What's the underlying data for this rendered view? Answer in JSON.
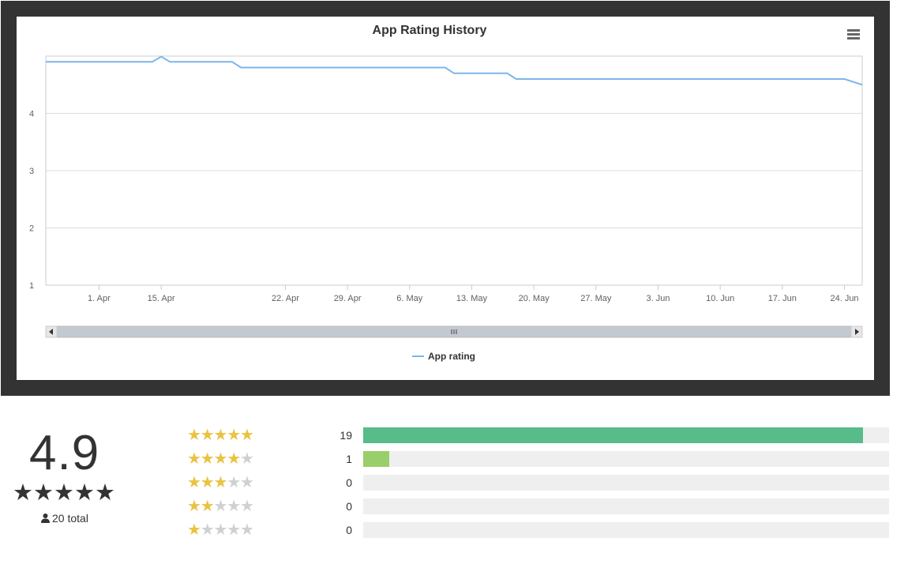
{
  "chart_data": {
    "type": "line",
    "title": "App Rating History",
    "xlabel": "",
    "ylabel": "",
    "x_range": [
      "2019-03-26",
      "2019-06-26"
    ],
    "ylim": [
      1,
      5
    ],
    "y_ticks": [
      "1",
      "2",
      "3",
      "4"
    ],
    "x_ticks": [
      {
        "date": "2019-04-01",
        "label": "1. Apr"
      },
      {
        "date": "2019-04-08",
        "label": "15. Apr",
        "shown_date": "2019-04-15"
      },
      {
        "date": "2019-04-22",
        "label": "22. Apr"
      },
      {
        "date": "2019-04-29",
        "label": "29. Apr"
      },
      {
        "date": "2019-05-06",
        "label": "6. May"
      },
      {
        "date": "2019-05-13",
        "label": "13. May"
      },
      {
        "date": "2019-05-20",
        "label": "20. May"
      },
      {
        "date": "2019-05-27",
        "label": "27. May"
      },
      {
        "date": "2019-06-03",
        "label": "3. Jun"
      },
      {
        "date": "2019-06-10",
        "label": "10. Jun"
      },
      {
        "date": "2019-06-17",
        "label": "17. Jun"
      },
      {
        "date": "2019-06-24",
        "label": "24. Jun"
      }
    ],
    "grid": true,
    "legend": "bottom-center",
    "series": [
      {
        "name": "App rating",
        "color": "#7cb5ec",
        "points": [
          [
            "2019-03-26",
            4.9
          ],
          [
            "2019-04-07",
            4.9
          ],
          [
            "2019-04-08",
            4.99
          ],
          [
            "2019-04-09",
            4.9
          ],
          [
            "2019-04-16",
            4.9
          ],
          [
            "2019-04-17",
            4.8
          ],
          [
            "2019-05-10",
            4.8
          ],
          [
            "2019-05-11",
            4.7
          ],
          [
            "2019-05-17",
            4.7
          ],
          [
            "2019-05-18",
            4.6
          ],
          [
            "2019-06-24",
            4.6
          ],
          [
            "2019-06-26",
            4.5
          ]
        ]
      }
    ]
  },
  "summary": {
    "score": "4.9",
    "score_stars": "★★★★★",
    "total_label": "20 total",
    "rows": [
      {
        "stars": 5,
        "count": "19",
        "fill": 0.95,
        "color": "#57bb8a"
      },
      {
        "stars": 4,
        "count": "1",
        "fill": 0.05,
        "color": "#9ace6a"
      },
      {
        "stars": 3,
        "count": "0",
        "fill": 0,
        "color": "#ffcf02"
      },
      {
        "stars": 2,
        "count": "0",
        "fill": 0,
        "color": "#ff9f02"
      },
      {
        "stars": 1,
        "count": "0",
        "fill": 0,
        "color": "#ff6f31"
      }
    ]
  },
  "colors": {
    "frame": "#333333",
    "star_on": "#e9c341",
    "star_off": "#cfd0d0"
  },
  "icons": [
    "menu-icon",
    "user-icon",
    "scroll-left-icon",
    "scroll-right-icon",
    "scroll-grip-icon"
  ]
}
